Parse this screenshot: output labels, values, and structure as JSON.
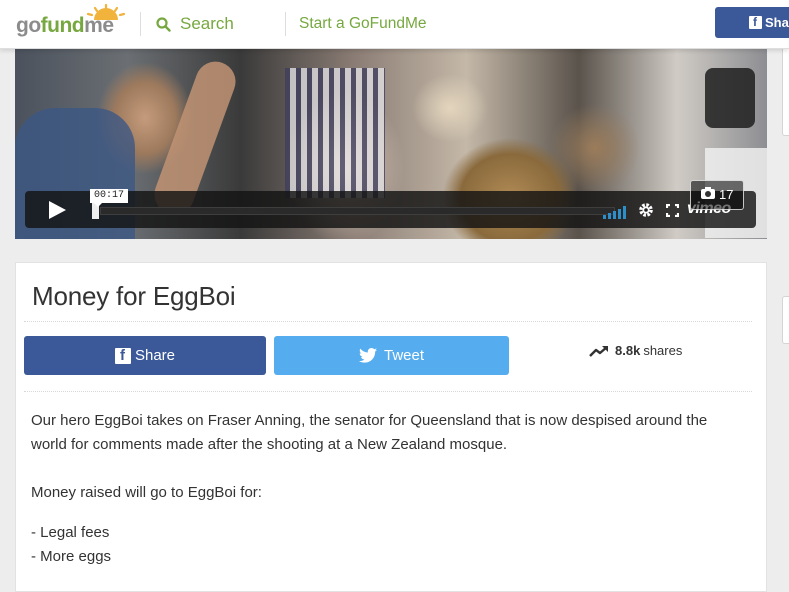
{
  "header": {
    "logo_part1": "go",
    "logo_part2": "fund",
    "logo_part3": "me",
    "search_label": "Search",
    "start_label": "Start a GoFundMe",
    "share_label": "Sha"
  },
  "video": {
    "time": "00:17",
    "photo_count": "17",
    "brand": "vimeo",
    "progress": 0.0
  },
  "campaign": {
    "title": "Money for EggBoi",
    "share_button": "Share",
    "tweet_button": "Tweet",
    "shares_count": "8.8k",
    "shares_label": "shares",
    "paragraph1": "Our hero EggBoi takes on Fraser Anning, the senator for Queensland that is now despised around the world for comments made after the shooting at a New Zealand mosque.",
    "paragraph2": "Money raised will go to EggBoi for:",
    "list": [
      "- Legal fees",
      "- More eggs"
    ]
  },
  "colors": {
    "brand_green": "#76a83f",
    "facebook_blue": "#3b5998",
    "twitter_blue": "#55acee",
    "vimeo_volume": "#2d8ec9"
  }
}
